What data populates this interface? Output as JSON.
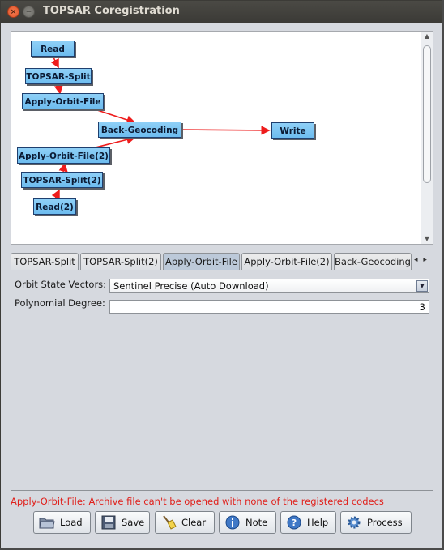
{
  "window": {
    "title": "TOPSAR Coregistration",
    "close_glyph": "×",
    "minimize_glyph": "−"
  },
  "graph": {
    "nodes": {
      "read": "Read",
      "topsar_split": "TOPSAR-Split",
      "apply_orbit_file": "Apply-Orbit-File",
      "back_geocoding": "Back-Geocoding",
      "write": "Write",
      "apply_orbit_file_2": "Apply-Orbit-File(2)",
      "topsar_split_2": "TOPSAR-Split(2)",
      "read_2": "Read(2)"
    },
    "edge_color": "#ee1c1c",
    "node_color": "#7ec6f3"
  },
  "scrollbar": {
    "up_glyph": "▲",
    "down_glyph": "▼"
  },
  "tabs": {
    "items": [
      {
        "label": "TOPSAR-Split",
        "active": false
      },
      {
        "label": "TOPSAR-Split(2)",
        "active": false
      },
      {
        "label": "Apply-Orbit-File",
        "active": true
      },
      {
        "label": "Apply-Orbit-File(2)",
        "active": false
      },
      {
        "label": "Back-Geocoding",
        "active": false
      }
    ],
    "nav_glyphs": "◂ ▸"
  },
  "params": {
    "orbit_label": "Orbit State Vectors:",
    "orbit_value": "Sentinel Precise (Auto Download)",
    "orbit_dropdown_glyph": "▼",
    "poly_label": "Polynomial Degree:",
    "poly_value": "3"
  },
  "status": {
    "error": "Apply-Orbit-File: Archive file can't be opened with none of the registered codecs",
    "error_color": "#e0201b"
  },
  "buttons": {
    "load": "Load",
    "save": "Save",
    "clear": "Clear",
    "note": "Note",
    "help": "Help",
    "process": "Process"
  },
  "icons": [
    "folder-icon",
    "floppy-disk-icon",
    "broom-icon",
    "info-icon",
    "help-icon",
    "gear-icon"
  ]
}
